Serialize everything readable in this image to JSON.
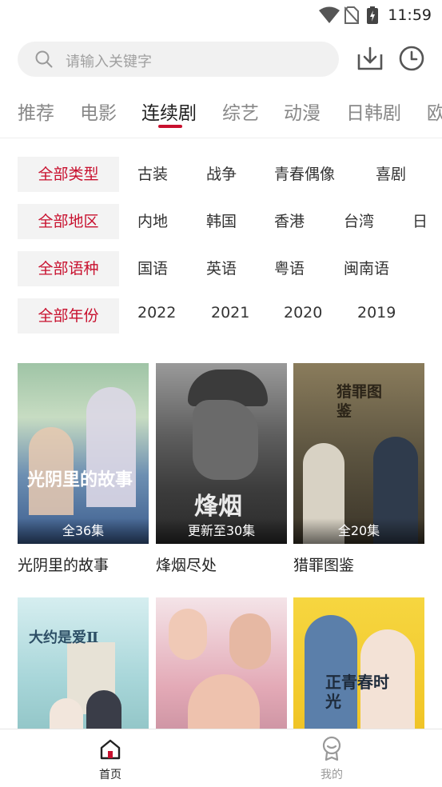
{
  "status_bar": {
    "time": "11:59"
  },
  "search": {
    "placeholder": "请输入关键字"
  },
  "tabs": [
    {
      "label": "推荐",
      "active": false
    },
    {
      "label": "电影",
      "active": false
    },
    {
      "label": "连续剧",
      "active": true
    },
    {
      "label": "综艺",
      "active": false
    },
    {
      "label": "动漫",
      "active": false
    },
    {
      "label": "日韩剧",
      "active": false
    },
    {
      "label": "欧",
      "active": false
    }
  ],
  "filters": [
    {
      "selected": "全部类型",
      "options": [
        "古装",
        "战争",
        "青春偶像",
        "喜剧"
      ]
    },
    {
      "selected": "全部地区",
      "options": [
        "内地",
        "韩国",
        "香港",
        "台湾",
        "日"
      ]
    },
    {
      "selected": "全部语种",
      "options": [
        "国语",
        "英语",
        "粤语",
        "闽南语"
      ]
    },
    {
      "selected": "全部年份",
      "options": [
        "2022",
        "2021",
        "2020",
        "2019"
      ]
    }
  ],
  "shows": [
    {
      "title": "光阴里的故事",
      "badge": "全36集",
      "poster_text": "光阴里的故事"
    },
    {
      "title": "烽烟尽处",
      "badge": "更新至30集",
      "poster_text": "烽烟"
    },
    {
      "title": "猎罪图鉴",
      "badge": "全20集",
      "poster_text": "猎罪图鉴"
    },
    {
      "title": "",
      "badge": "",
      "poster_text": "大约是爱Ⅱ"
    },
    {
      "title": "",
      "badge": "",
      "poster_text": ""
    },
    {
      "title": "",
      "badge": "",
      "poster_text": "正青春时光"
    }
  ],
  "bottom_nav": [
    {
      "label": "首页",
      "active": true
    },
    {
      "label": "我的",
      "active": false
    }
  ],
  "colors": {
    "accent": "#c8102e",
    "inactive_tab": "#888888",
    "filter_bg": "#f3f3f3"
  }
}
